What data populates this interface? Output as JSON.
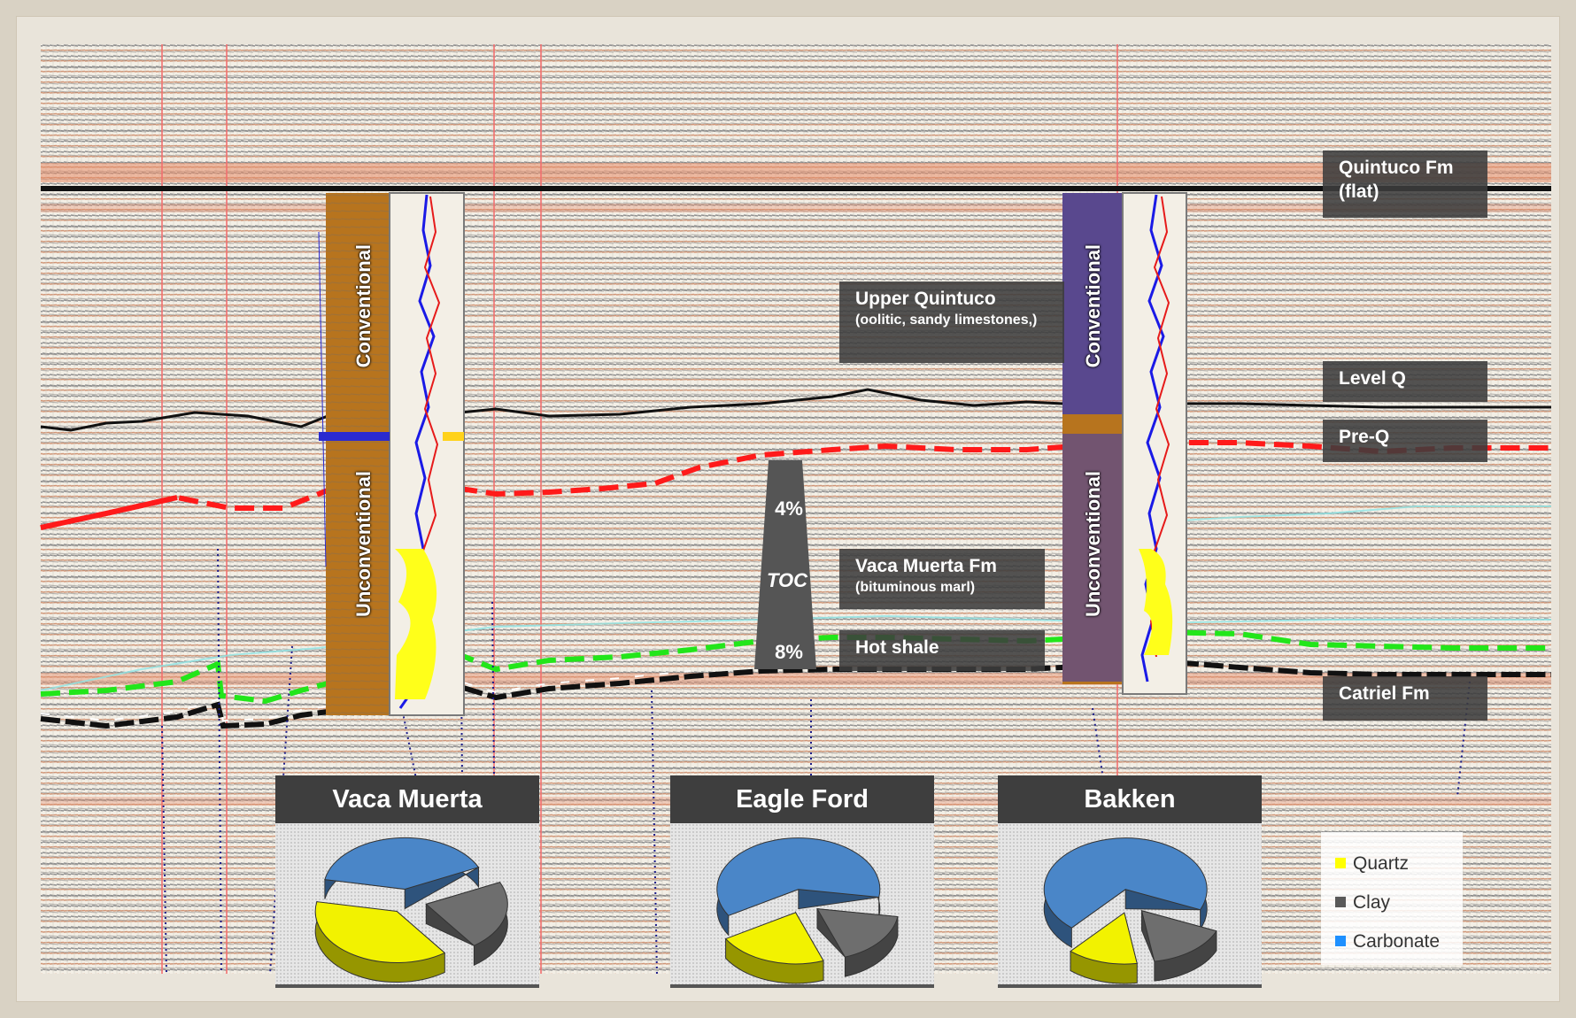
{
  "labels": {
    "quintuco_flat": "Quintuco Fm (flat)",
    "upper_quintuco_title": "Upper Quintuco",
    "upper_quintuco_sub": "(oolitic, sandy limestones,)",
    "level_q": "Level Q",
    "pre_q": "Pre-Q",
    "vaca_muerta_fm_title": "Vaca Muerta Fm",
    "vaca_muerta_fm_sub": "(bituminous marl)",
    "hot_shale": "Hot shale",
    "catriel_fm": "Catriel Fm"
  },
  "wells": [
    {
      "conventional": "Conventional",
      "unconventional": "Unconventional"
    },
    {
      "conventional": "Conventional",
      "unconventional": "Unconventional"
    }
  ],
  "toc": {
    "top": "4%",
    "label": "TOC",
    "bottom": "8%"
  },
  "shales": [
    {
      "name": "Vaca Muerta",
      "quartz": 0.38,
      "clay": 0.22,
      "carbonate": 0.4
    },
    {
      "name": "Eagle Ford",
      "quartz": 0.22,
      "clay": 0.17,
      "carbonate": 0.61
    },
    {
      "name": "Bakken",
      "quartz": 0.14,
      "clay": 0.16,
      "carbonate": 0.7
    }
  ],
  "legend": [
    {
      "name": "Quartz",
      "color": "#ffff00"
    },
    {
      "name": "Clay",
      "color": "#595959"
    },
    {
      "name": "Carbonate",
      "color": "#1e90ff"
    }
  ],
  "colors": {
    "quartz": "#f2f200",
    "clay": "#6e6e6e",
    "carbonate": "#4a86c8",
    "pre_q_line": "#ff1a1a",
    "hot_shale_line": "#22e61a",
    "tag_background": "#3c3c3c"
  }
}
